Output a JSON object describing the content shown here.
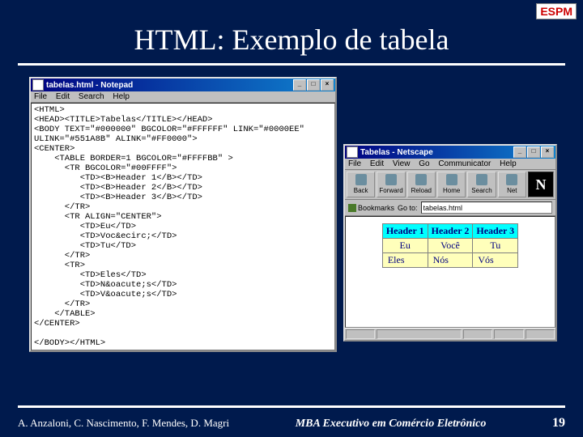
{
  "slide": {
    "logo": "ESPM",
    "title": "HTML: Exemplo de tabela",
    "authors": "A. Anzaloni, C. Nascimento, F. Mendes, D. Magri",
    "course": "MBA Executivo em Comércio Eletrônico",
    "page": "19"
  },
  "notepad": {
    "title": "tabelas.html - Notepad",
    "menu": [
      "File",
      "Edit",
      "Search",
      "Help"
    ],
    "buttons": {
      "min": "_",
      "max": "□",
      "close": "×"
    },
    "code": "<HTML>\n<HEAD><TITLE>Tabelas</TITLE></HEAD>\n<BODY TEXT=\"#000000\" BGCOLOR=\"#FFFFFF\" LINK=\"#0000EE\"\nULINK=\"#551A8B\" ALINK=\"#FF0000\">\n<CENTER>\n    <TABLE BORDER=1 BGCOLOR=\"#FFFFBB\" >\n      <TR BGCOLOR=\"#00FFFF\">\n         <TD><B>Header 1</B></TD>\n         <TD><B>Header 2</B></TD>\n         <TD><B>Header 3</B></TD>\n      </TR>\n      <TR ALIGN=\"CENTER\">\n         <TD>Eu</TD>\n         <TD>Voc&ecirc;</TD>\n         <TD>Tu</TD>\n      </TR>\n      <TR>\n         <TD>Eles</TD>\n         <TD>N&oacute;s</TD>\n         <TD>V&oacute;s</TD>\n      </TR>\n    </TABLE>\n</CENTER>\n\n</BODY></HTML>"
  },
  "netscape": {
    "title": "Tabelas - Netscape",
    "menu": [
      "File",
      "Edit",
      "View",
      "Go",
      "Communicator",
      "Help"
    ],
    "toolbar": [
      "Back",
      "Forward",
      "Reload",
      "Home",
      "Search",
      "Net"
    ],
    "bookmarks_label": "Bookmarks",
    "goto_label": "Go to:",
    "location": "tabelas.html",
    "logo": "N",
    "table": {
      "headers": [
        "Header 1",
        "Header 2",
        "Header 3"
      ],
      "rows": [
        [
          "Eu",
          "Você",
          "Tu"
        ],
        [
          "Eles",
          "Nós",
          "Vós"
        ]
      ]
    }
  }
}
